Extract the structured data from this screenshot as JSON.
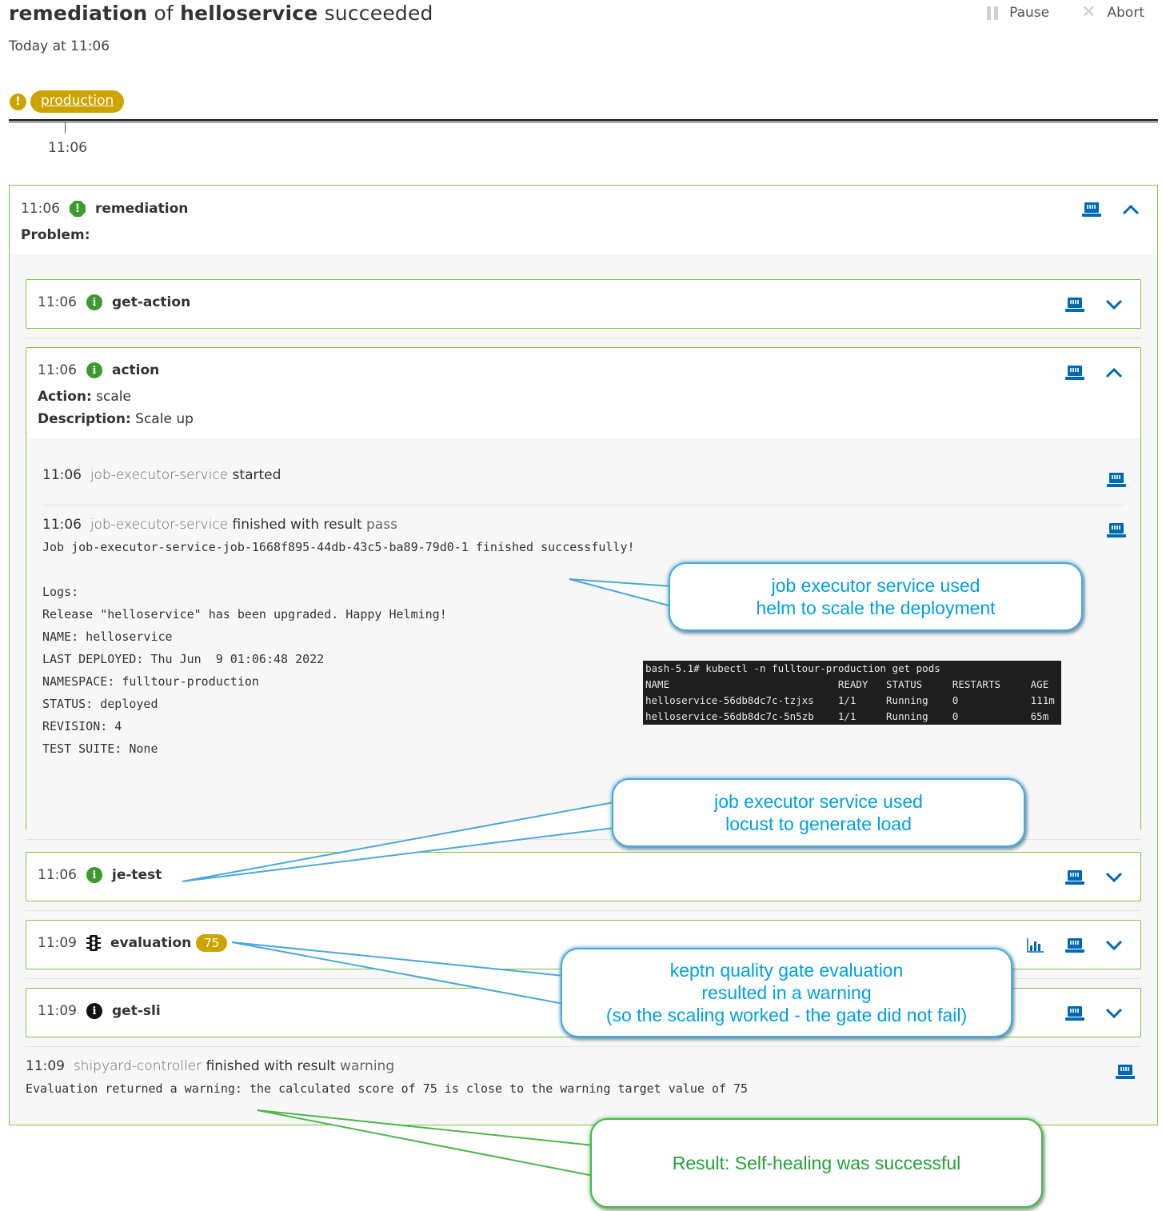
{
  "header": {
    "title_parts": {
      "sequence": "remediation",
      "of": "of",
      "service": "helloservice",
      "status": "succeeded"
    },
    "subtitle": "Today at 11:06",
    "actions": {
      "pause": "Pause",
      "abort": "Abort"
    }
  },
  "stage": {
    "name": "production",
    "status": "warning",
    "status_icon": "exclamation-icon",
    "color": "#cca300",
    "time": "11:06"
  },
  "sequence": {
    "time": "11:06",
    "name": "remediation",
    "problem_label": "Problem:",
    "problem_value": "",
    "tasks": [
      {
        "time": "11:06",
        "name": "get-action",
        "icon": "info-icon",
        "expanded": false
      },
      {
        "time": "11:06",
        "name": "action",
        "icon": "info-icon",
        "expanded": true,
        "action_label": "Action:",
        "action_value": "scale",
        "description_label": "Description:",
        "description_value": "Scale up",
        "events": [
          {
            "time": "11:06",
            "service": "job-executor-service",
            "text": "started"
          },
          {
            "time": "11:06",
            "service": "job-executor-service",
            "text": "finished with result",
            "result": "pass",
            "message": "Job job-executor-service-job-1668f895-44db-43c5-ba89-79d0-1 finished successfully!\n\nLogs:\nRelease \"helloservice\" has been upgraded. Happy Helming!\nNAME: helloservice\nLAST DEPLOYED: Thu Jun  9 01:06:48 2022\nNAMESPACE: fulltour-production\nSTATUS: deployed\nREVISION: 4\nTEST SUITE: None"
          }
        ]
      },
      {
        "time": "11:06",
        "name": "je-test",
        "icon": "info-icon",
        "expanded": false
      },
      {
        "time": "11:09",
        "name": "evaluation",
        "icon": "traffic-light-icon",
        "score": "75",
        "score_color": "#cca300",
        "expanded": false
      },
      {
        "time": "11:09",
        "name": "get-sli",
        "icon": "info-icon",
        "expanded": false
      }
    ],
    "final_event": {
      "time": "11:09",
      "service": "shipyard-controller",
      "text": "finished with result",
      "result": "warning",
      "message": "Evaluation returned a warning: the calculated score of 75 is close to the warning target value of 75"
    }
  },
  "terminal": {
    "command": "bash-5.1# kubectl -n fulltour-production get pods",
    "headers": [
      "NAME",
      "READY",
      "STATUS",
      "RESTARTS",
      "AGE"
    ],
    "rows": [
      [
        "helloservice-56db8dc7c-tzjxs",
        "1/1",
        "Running",
        "0",
        "111m"
      ],
      [
        "helloservice-56db8dc7c-5n5zb",
        "1/1",
        "Running",
        "0",
        "65m"
      ]
    ]
  },
  "annotations": [
    {
      "line1": "job executor service used",
      "line2": "helm to scale the deployment"
    },
    {
      "line1": "job executor service used",
      "line2": "locust to generate load"
    },
    {
      "line1": "keptn quality gate evaluation",
      "line2": "resulted in a warning",
      "line3": "(so the scaling worked - the gate did not fail)"
    },
    {
      "line1": "Result: Self-healing was successful"
    }
  ]
}
